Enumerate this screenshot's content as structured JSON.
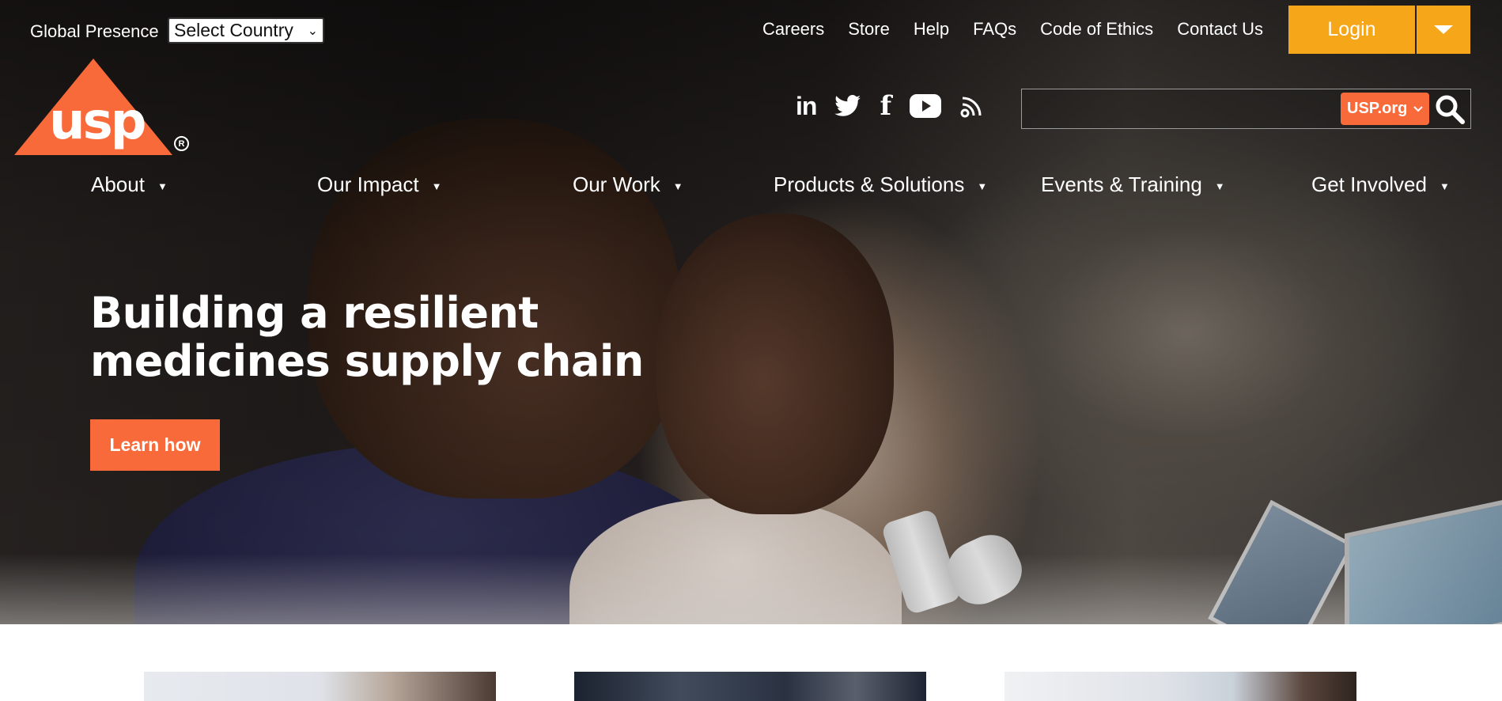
{
  "header": {
    "global_presence_label": "Global Presence",
    "country_select_value": "Select Country",
    "util_links": [
      "Careers",
      "Store",
      "Help",
      "FAQs",
      "Code of Ethics",
      "Contact Us"
    ],
    "login_label": "Login"
  },
  "logo": {
    "text": "usp",
    "registered": "R"
  },
  "social": [
    "linkedin-icon",
    "twitter-icon",
    "facebook-icon",
    "youtube-icon",
    "rss-icon"
  ],
  "search": {
    "site_select_value": "USP.org",
    "value": ""
  },
  "nav": {
    "items": [
      "About",
      "Our Impact",
      "Our Work",
      "Products & Solutions",
      "Events & Training",
      "Get Involved"
    ]
  },
  "hero": {
    "headline_line1": "Building a resilient",
    "headline_line2": "medicines supply chain",
    "cta_label": "Learn how"
  },
  "colors": {
    "brand_orange": "#f96a3a",
    "login_yellow": "#f6a619"
  }
}
